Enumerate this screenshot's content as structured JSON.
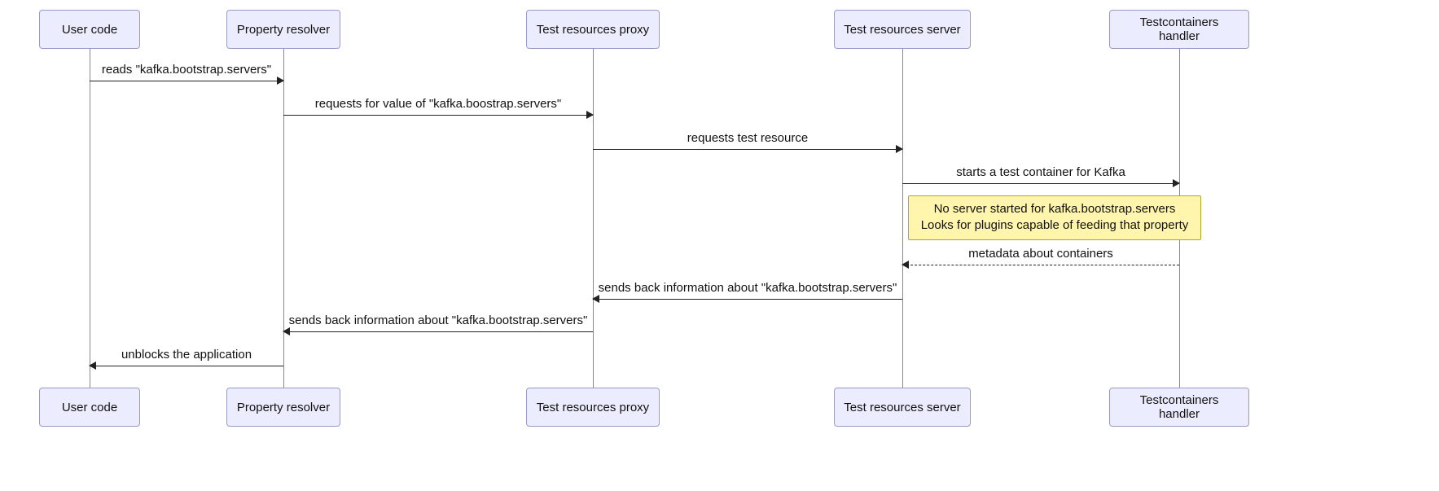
{
  "actors": {
    "user_code": "User code",
    "property_resolver": "Property resolver",
    "proxy": "Test resources proxy",
    "server": "Test resources server",
    "handler": "Testcontainers handler"
  },
  "messages": {
    "m1": "reads \"kafka.bootstrap.servers\"",
    "m2": "requests for value of \"kafka.boostrap.servers\"",
    "m3": "requests test resource",
    "m4": "starts a test container for Kafka",
    "m5": "metadata about containers",
    "m6": "sends back information about \"kafka.bootstrap.servers\"",
    "m7": "sends back information about \"kafka.bootstrap.servers\"",
    "m8": "unblocks the application"
  },
  "note": {
    "line1": "No server started for kafka.bootstrap.servers",
    "line2": "Looks for plugins capable of feeding that property"
  },
  "colors": {
    "actor_bg": "#ECECFF",
    "note_bg": "#FFF5AD"
  }
}
